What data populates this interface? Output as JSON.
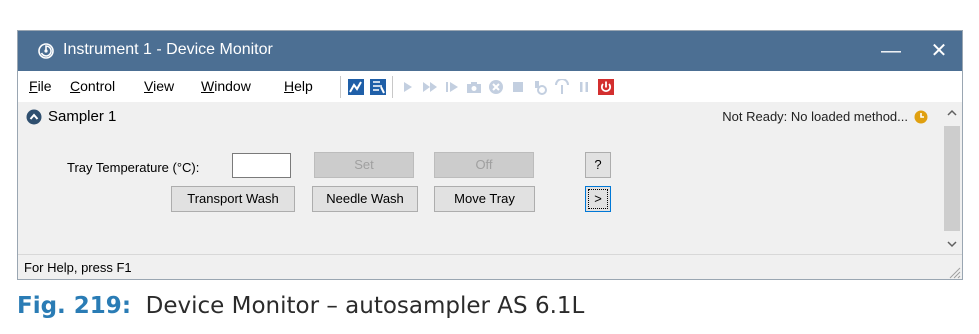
{
  "window": {
    "title": "Instrument 1 - Device Monitor",
    "minimize_glyph": "—",
    "close_glyph": "✕"
  },
  "menu": {
    "file": {
      "mnemonic": "F",
      "rest": "ile"
    },
    "control": {
      "mnemonic": "C",
      "rest": "ontrol"
    },
    "view": {
      "mnemonic": "V",
      "rest": "iew"
    },
    "window": {
      "mnemonic": "W",
      "rest": "indow"
    },
    "help": {
      "mnemonic": "H",
      "rest": "elp"
    }
  },
  "toolbar_icons": [
    "chart-icon",
    "report-icon",
    "play-icon",
    "fast-forward-icon",
    "step-icon",
    "camera-icon",
    "cancel-icon",
    "stop-icon",
    "purge-icon",
    "wash-icon",
    "pause-icon",
    "power-icon"
  ],
  "device": {
    "name": "Sampler 1",
    "status": "Not Ready: No loaded method..."
  },
  "controls": {
    "tray_temp_label": "Tray Temperature (°C):",
    "tray_temp_value": "",
    "set_label": "Set",
    "off_label": "Off",
    "help_label": "?",
    "transport_wash_label": "Transport Wash",
    "needle_wash_label": "Needle Wash",
    "move_tray_label": "Move Tray",
    "more_label": ">"
  },
  "statusbar": {
    "help_text": "For Help, press F1"
  },
  "caption": {
    "fig_label": "Fig. 219:",
    "text": "Device Monitor – autosampler AS 6.1L"
  },
  "colors": {
    "titlebar": "#4c6f93",
    "caption_accent": "#2a7cb5",
    "status_clock": "#e0a010",
    "power_red": "#d32f2f"
  }
}
